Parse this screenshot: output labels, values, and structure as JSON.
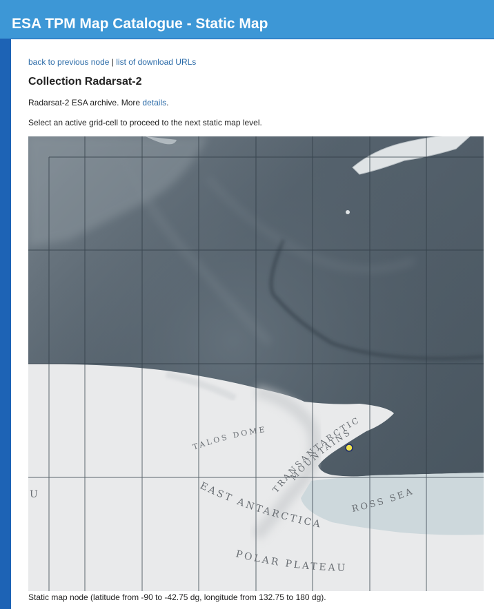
{
  "header": {
    "title": "ESA TPM Map Catalogue - Static Map"
  },
  "nav": {
    "back_link": "back to previous node",
    "separator": "|",
    "downloads_link": "list of download URLs"
  },
  "collection": {
    "title": "Collection Radarsat-2",
    "description_prefix": "Radarsat-2 ESA archive. More",
    "details_link": "details",
    "description_suffix": "."
  },
  "instruction": "Select an active grid-cell to proceed to the next static map level.",
  "map": {
    "labels": {
      "talos_dome": "TALOS DOME",
      "transantarctic": "TRANSANTARCTIC",
      "mountains": "MOUNTAINS",
      "east_antarctica": "EAST ANTARCTICA",
      "ross_sea": "ROSS SEA",
      "polar_plateau": "POLAR PLATEAU",
      "edge_letter": "U"
    },
    "marker_color": "#f2e34a",
    "ocean_color": "#5f6b76",
    "ice_color": "#e9eaeb",
    "shelf_color": "#cdd8dc"
  },
  "caption": "Static map node (latitude from -90 to -42.75 dg, longitude from 132.75 to 180 dg)."
}
